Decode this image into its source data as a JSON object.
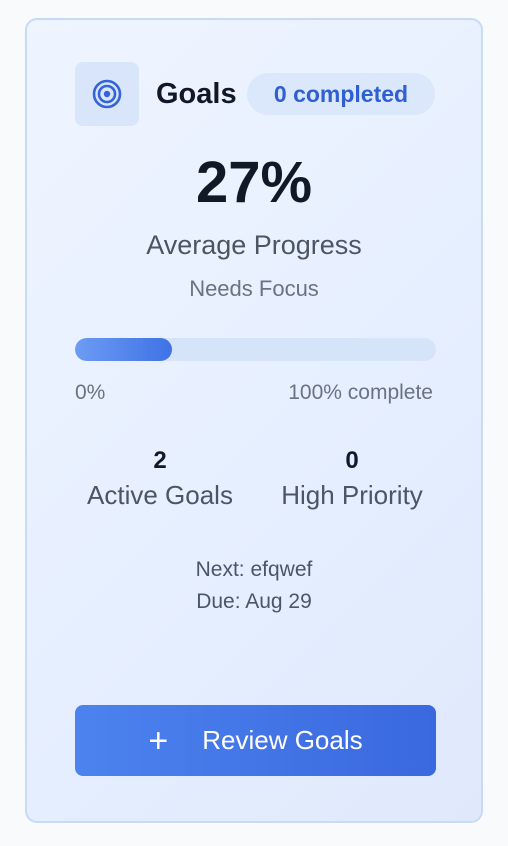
{
  "card": {
    "icon": "target-icon",
    "title": "Goals",
    "badge": "0 completed",
    "percent_text": "27%",
    "percent_label": "Average Progress",
    "status": "Needs Focus",
    "progress": {
      "value_percent": 27,
      "min_label": "0%",
      "max_label": "100% complete"
    },
    "stats": [
      {
        "value": "2",
        "label": "Active Goals"
      },
      {
        "value": "0",
        "label": "High Priority"
      }
    ],
    "next": "Next: efqwef",
    "due": "Due: Aug 29",
    "button": {
      "icon": "plus-icon",
      "label": "Review Goals"
    }
  },
  "colors": {
    "accent": "#3f72e6",
    "badge_text": "#2f5fd3",
    "card_border": "#c7dbf7"
  }
}
